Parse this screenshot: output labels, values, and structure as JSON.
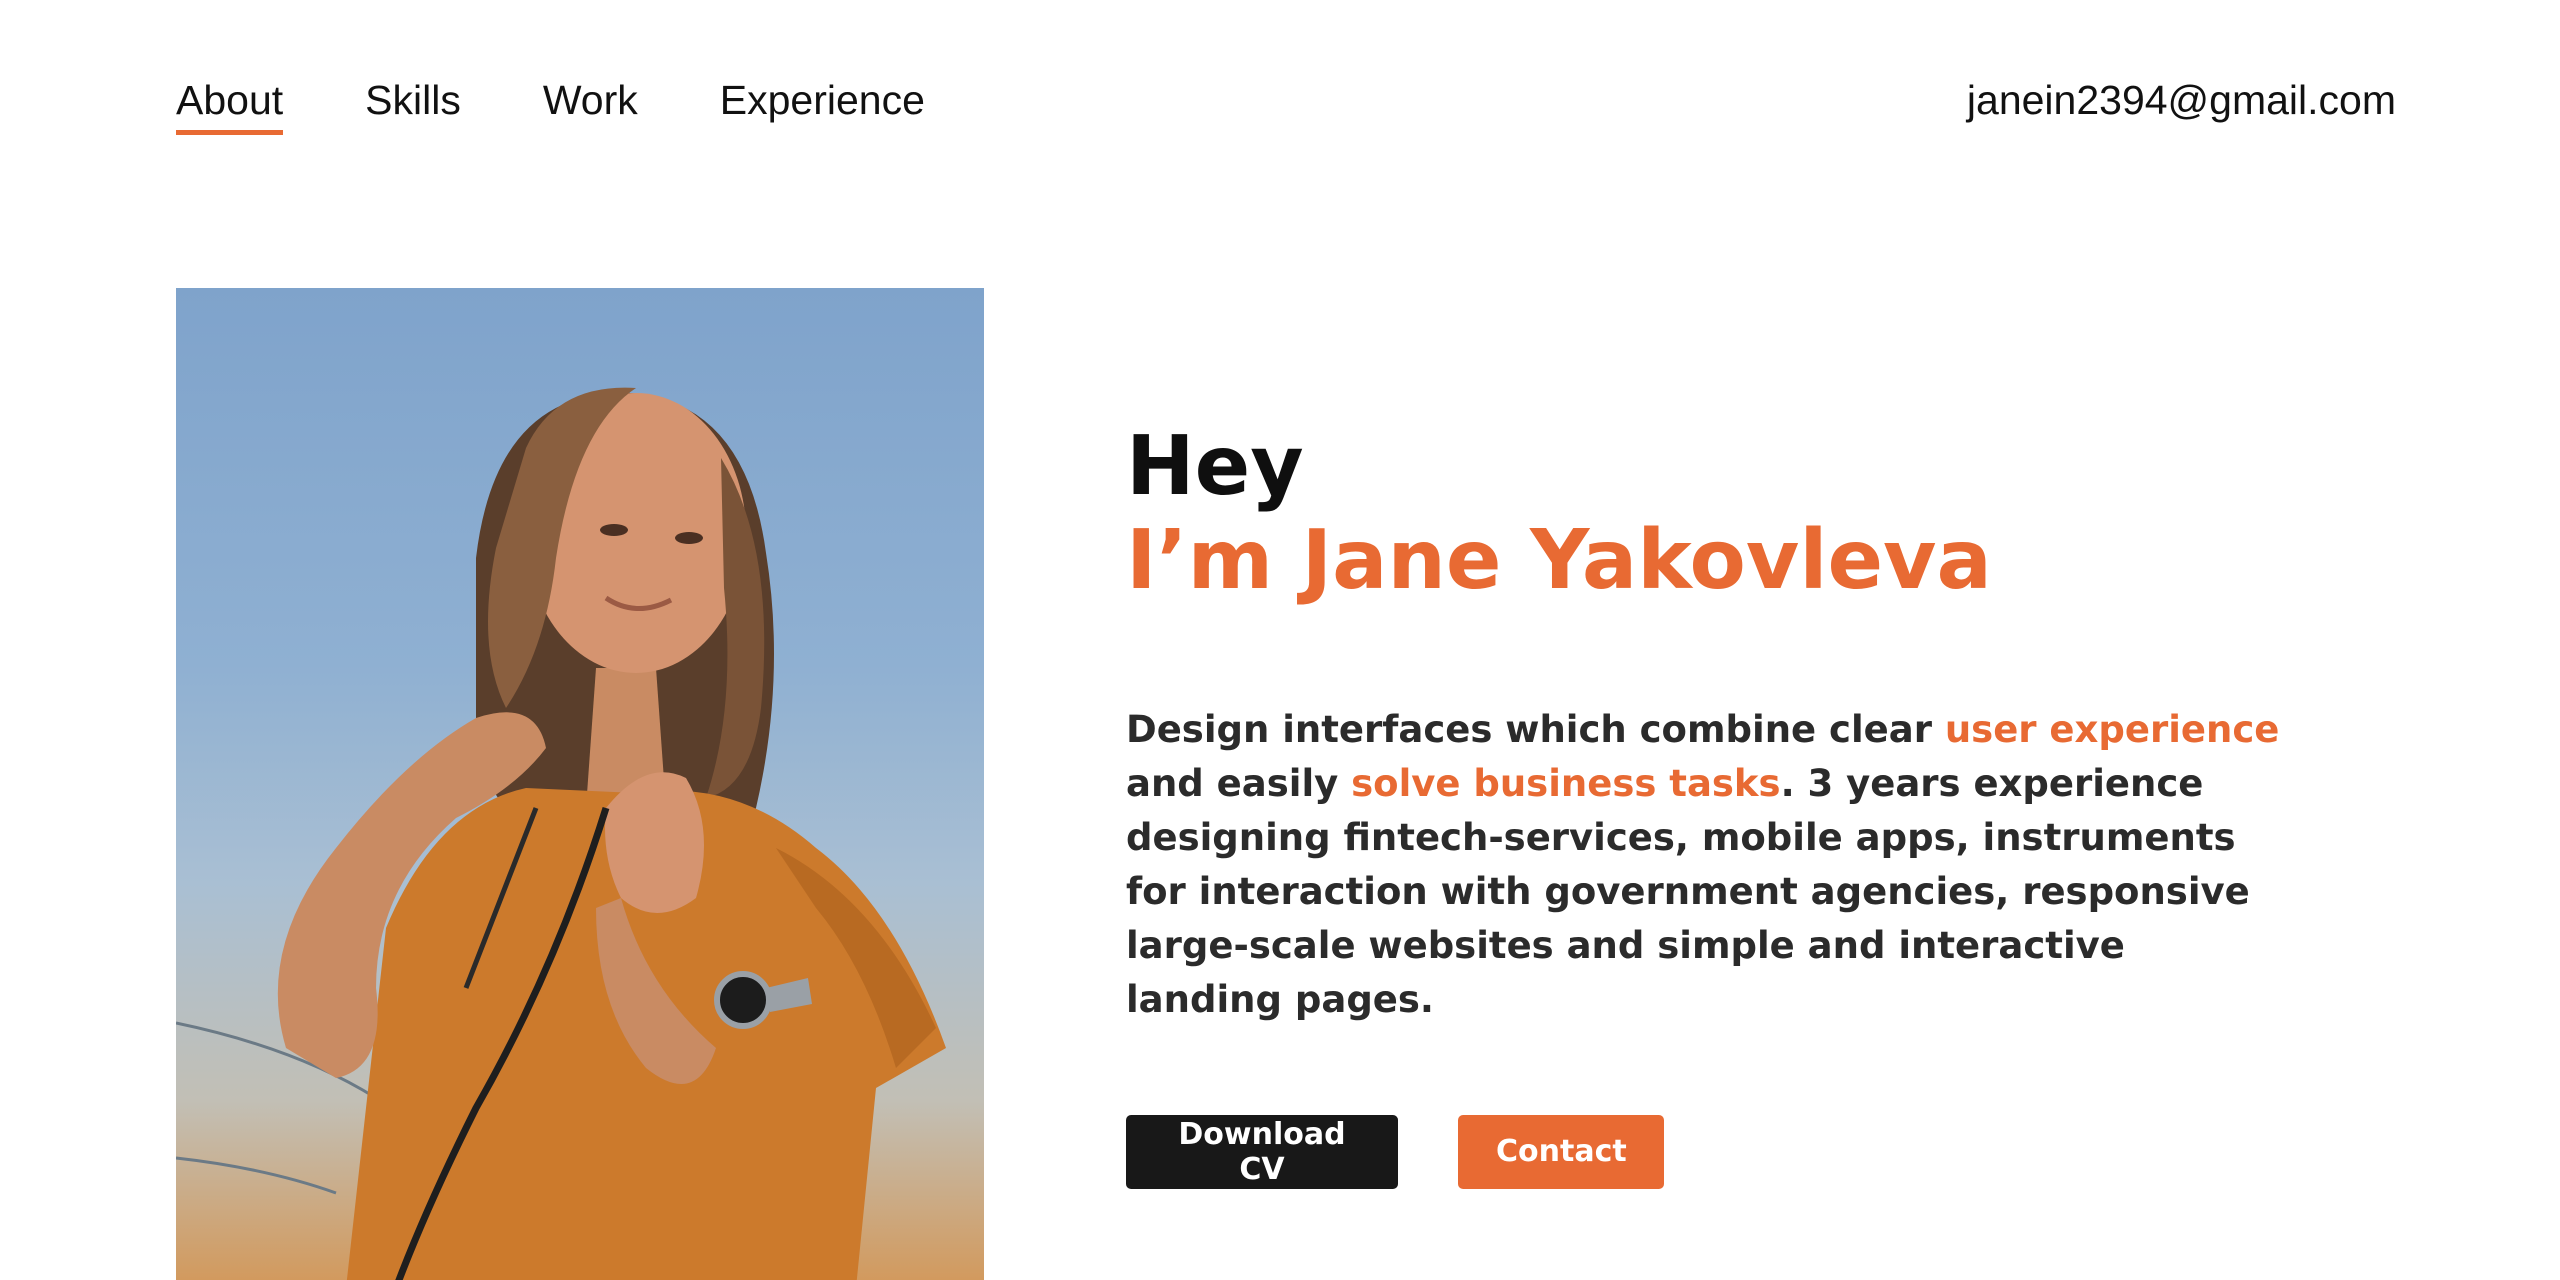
{
  "nav": {
    "items": [
      {
        "label": "About",
        "active": true
      },
      {
        "label": "Skills",
        "active": false
      },
      {
        "label": "Work",
        "active": false
      },
      {
        "label": "Experience",
        "active": false
      }
    ]
  },
  "header": {
    "email": "janein2394@gmail.com"
  },
  "hero": {
    "greeting": "Hey",
    "name": "I’m Jane Yakovleva",
    "bio": {
      "part1": "Design interfaces which combine clear ",
      "highlight1": "user experience",
      "part2": " and easily ",
      "highlight2": "solve business tasks",
      "part3": ". 3 years experience designing fintech-services, mobile apps, instruments for interaction with government agencies, responsive large-scale websites and simple and interactive landing pages."
    },
    "buttons": {
      "download": "Download CV",
      "contact": "Contact"
    }
  },
  "colors": {
    "accent": "#e86a33",
    "dark_button": "#181818",
    "text": "#111111"
  }
}
